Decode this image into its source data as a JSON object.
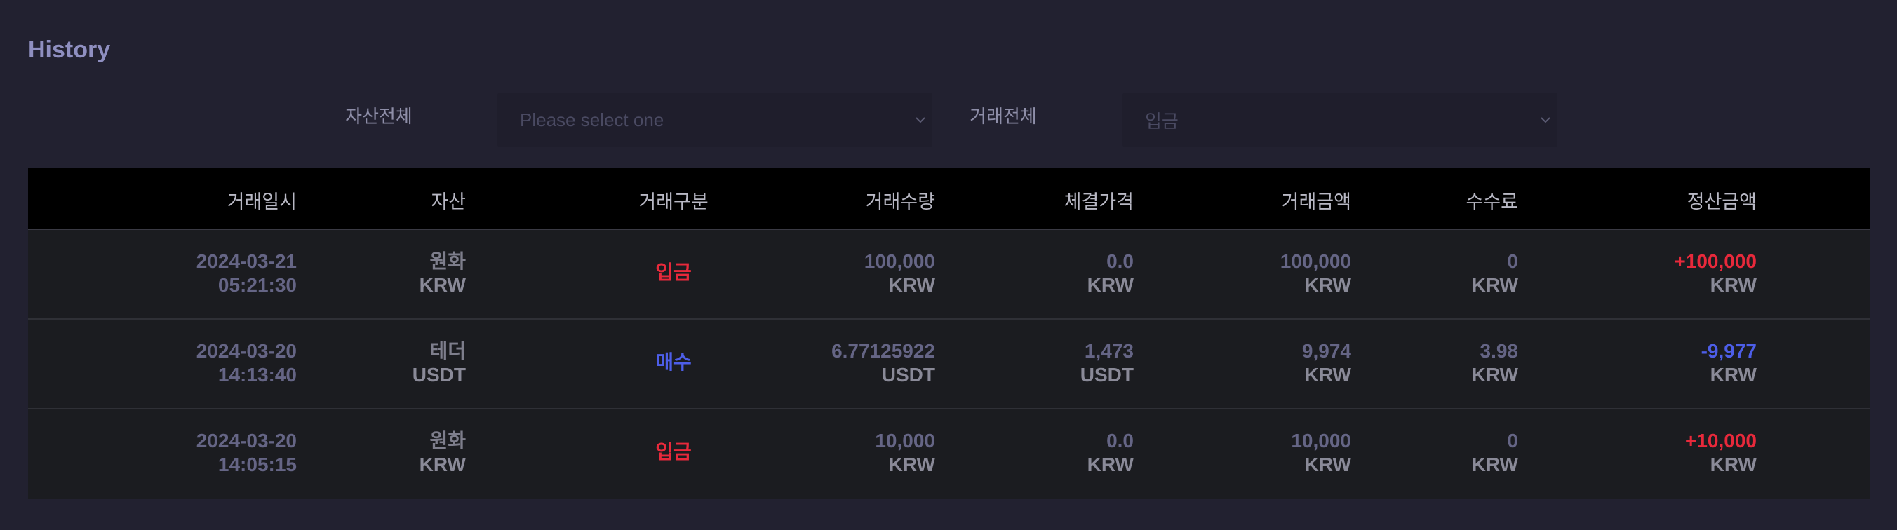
{
  "page": {
    "title": "History"
  },
  "filters": {
    "asset": {
      "label": "자산전체",
      "value": "Please select one"
    },
    "trade": {
      "label": "거래전체",
      "value": "입금"
    }
  },
  "table": {
    "headers": {
      "date": "거래일시",
      "asset": "자산",
      "type": "거래구분",
      "qty": "거래수량",
      "price": "체결가격",
      "amount": "거래금액",
      "fee": "수수료",
      "net": "정산금액"
    },
    "rows": [
      {
        "date": "2024-03-21",
        "time": "05:21:30",
        "asset_name": "원화",
        "asset_code": "KRW",
        "type": "입금",
        "qty": "100,000",
        "qty_unit": "KRW",
        "price": "0.0",
        "price_unit": "KRW",
        "amount": "100,000",
        "amount_unit": "KRW",
        "fee": "0",
        "fee_unit": "KRW",
        "net": "+100,000",
        "net_unit": "KRW"
      },
      {
        "date": "2024-03-20",
        "time": "14:13:40",
        "asset_name": "테더",
        "asset_code": "USDT",
        "type": "매수",
        "qty": "6.77125922",
        "qty_unit": "USDT",
        "price": "1,473",
        "price_unit": "USDT",
        "amount": "9,974",
        "amount_unit": "KRW",
        "fee": "3.98",
        "fee_unit": "KRW",
        "net": "-9,977",
        "net_unit": "KRW"
      },
      {
        "date": "2024-03-20",
        "time": "14:05:15",
        "asset_name": "원화",
        "asset_code": "KRW",
        "type": "입금",
        "qty": "10,000",
        "qty_unit": "KRW",
        "price": "0.0",
        "price_unit": "KRW",
        "amount": "10,000",
        "amount_unit": "KRW",
        "fee": "0",
        "fee_unit": "KRW",
        "net": "+10,000",
        "net_unit": "KRW"
      }
    ]
  },
  "colors": {
    "background": "#222130",
    "deposit": "#e8293b",
    "buy": "#4d5ee8",
    "title": "#8f8fc0"
  },
  "icons": {
    "select_arrow": "chevron-down-icon"
  }
}
